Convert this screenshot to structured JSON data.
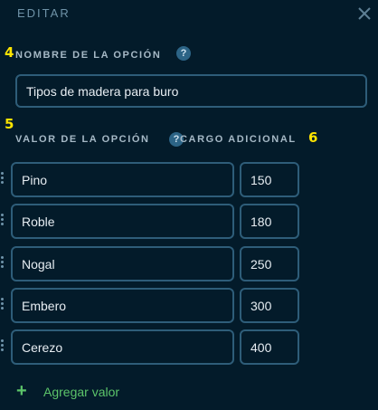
{
  "header": {
    "title": "EDITAR",
    "close_icon": "close-icon"
  },
  "markers": {
    "m4": "4",
    "m5": "5",
    "m6": "6"
  },
  "option_name": {
    "label": "NOMBRE DE LA OPCIÓN",
    "help": "?",
    "value": "Tipos de madera para buro"
  },
  "columns": {
    "value_label": "VALOR DE LA OPCIÓN",
    "value_help": "?",
    "charge_label": "CARGO ADICIONAL"
  },
  "values": [
    {
      "name": "Pino",
      "charge": "150"
    },
    {
      "name": "Roble",
      "charge": "180"
    },
    {
      "name": "Nogal",
      "charge": "250"
    },
    {
      "name": "Embero",
      "charge": "300"
    },
    {
      "name": "Cerezo",
      "charge": "400"
    }
  ],
  "add_value": {
    "icon": "+",
    "label": "Agregar valor"
  },
  "colors": {
    "background": "#031b2a",
    "border": "#2e5d79",
    "accent_green": "#5cc46a",
    "marker_yellow": "#ffe500"
  }
}
